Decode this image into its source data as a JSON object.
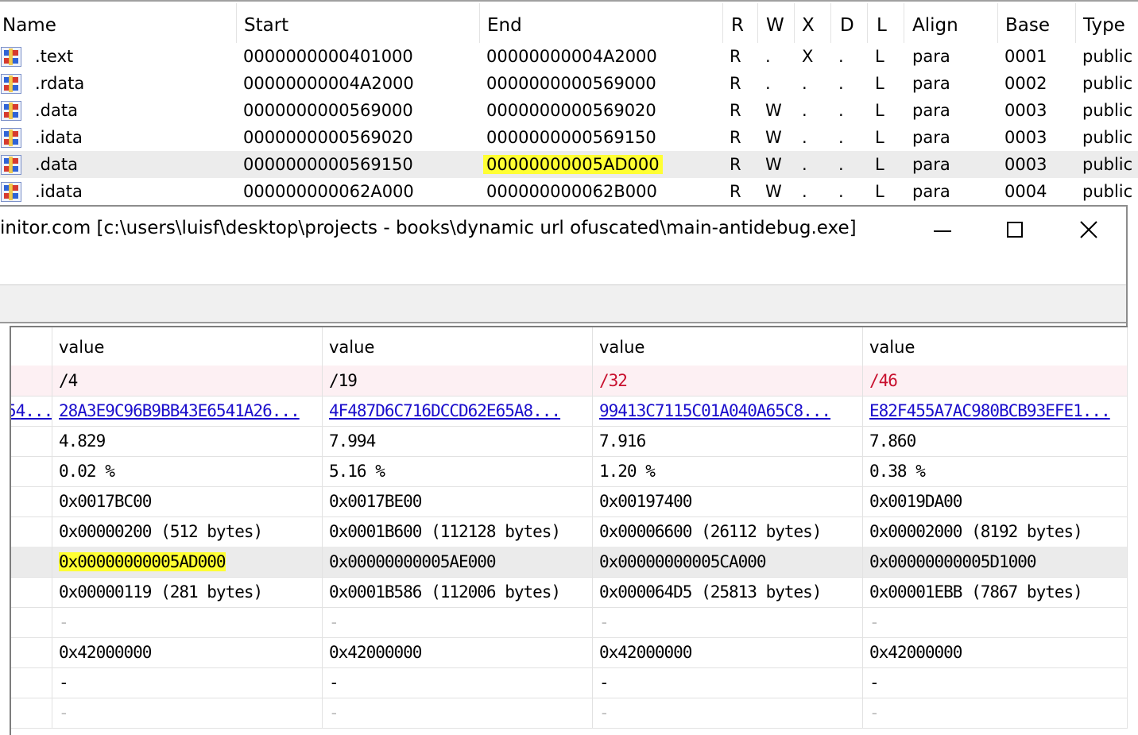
{
  "segments": {
    "columns": [
      "Name",
      "Start",
      "End",
      "R",
      "W",
      "X",
      "D",
      "L",
      "Align",
      "Base",
      "Type"
    ],
    "rows": [
      {
        "name": ".text",
        "start": "0000000000401000",
        "end": "00000000004A2000",
        "r": "R",
        "w": ".",
        "x": "X",
        "d": ".",
        "l": "L",
        "align": "para",
        "base": "0001",
        "type": "public"
      },
      {
        "name": ".rdata",
        "start": "00000000004A2000",
        "end": "0000000000569000",
        "r": "R",
        "w": ".",
        "x": ".",
        "d": ".",
        "l": "L",
        "align": "para",
        "base": "0002",
        "type": "public"
      },
      {
        "name": ".data",
        "start": "0000000000569000",
        "end": "0000000000569020",
        "r": "R",
        "w": "W",
        "x": ".",
        "d": ".",
        "l": "L",
        "align": "para",
        "base": "0003",
        "type": "public"
      },
      {
        "name": ".idata",
        "start": "0000000000569020",
        "end": "0000000000569150",
        "r": "R",
        "w": "W",
        "x": ".",
        "d": ".",
        "l": "L",
        "align": "para",
        "base": "0003",
        "type": "public"
      },
      {
        "name": ".data",
        "start": "0000000000569150",
        "end": "00000000005AD000",
        "r": "R",
        "w": "W",
        "x": ".",
        "d": ".",
        "l": "L",
        "align": "para",
        "base": "0003",
        "type": "public"
      },
      {
        "name": ".idata",
        "start": "000000000062A000",
        "end": "000000000062B000",
        "r": "R",
        "w": "W",
        "x": ".",
        "d": ".",
        "l": "L",
        "align": "para",
        "base": "0004",
        "type": "public"
      }
    ],
    "highlight_color": "#ffff33"
  },
  "window": {
    "title": "initor.com [c:\\users\\luisf\\desktop\\projects - books\\dynamic url ofuscated\\main-antidebug.exe]",
    "minimize_glyph": "—",
    "maximize_glyph": "☐",
    "close_glyph": "✕"
  },
  "grid": {
    "stub_link": "54...",
    "header": [
      "value",
      "value",
      "value",
      "value"
    ],
    "rows": [
      {
        "cells": [
          "/4",
          "/19",
          "/32",
          "/46"
        ]
      },
      {
        "cells": [
          "28A3E9C96B9BB43E6541A26...",
          "4F487D6C716DCCD62E65A8...",
          "99413C7115C01A040A65C8...",
          "E82F455A7AC980BCB93EFE1..."
        ]
      },
      {
        "cells": [
          "4.829",
          "7.994",
          "7.916",
          "7.860"
        ]
      },
      {
        "cells": [
          "0.02 %",
          "5.16 %",
          "1.20 %",
          "0.38 %"
        ]
      },
      {
        "cells": [
          "0x0017BC00",
          "0x0017BE00",
          "0x00197400",
          "0x0019DA00"
        ]
      },
      {
        "cells": [
          "0x00000200 (512 bytes)",
          "0x0001B600 (112128 bytes)",
          "0x00006600 (26112 bytes)",
          "0x00002000 (8192 bytes)"
        ]
      },
      {
        "cells": [
          "0x00000000005AD000",
          "0x00000000005AE000",
          "0x00000000005CA000",
          "0x00000000005D1000"
        ]
      },
      {
        "cells": [
          "0x00000119 (281 bytes)",
          "0x0001B586 (112006 bytes)",
          "0x000064D5 (25813 bytes)",
          "0x00001EBB (7867 bytes)"
        ]
      },
      {
        "cells": [
          "-",
          "-",
          "-",
          "-"
        ]
      },
      {
        "cells": [
          "0x42000000",
          "0x42000000",
          "0x42000000",
          "0x42000000"
        ]
      },
      {
        "cells": [
          "-",
          "-",
          "-",
          "-"
        ]
      },
      {
        "cells": [
          "-",
          "-",
          "-",
          "-"
        ]
      }
    ],
    "link_color": "#1a0dcc",
    "warning_color": "#c8102e"
  }
}
